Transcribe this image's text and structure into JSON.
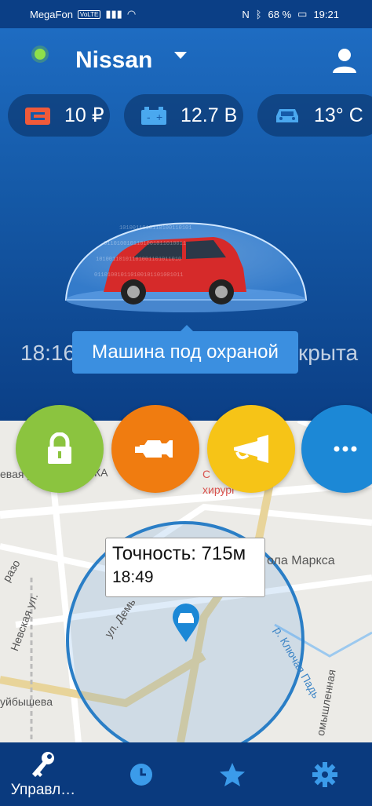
{
  "status_bar": {
    "carrier": "MegaFon",
    "volte": "VoLTE",
    "battery": "68 %",
    "time": "19:21"
  },
  "header": {
    "title": "Nissan"
  },
  "chips": [
    {
      "value": "10 ₽",
      "icon": "balance-icon"
    },
    {
      "value": "12.7 В",
      "icon": "battery-icon"
    },
    {
      "value": "13° C",
      "icon": "car-temperature-icon"
    }
  ],
  "status_row": {
    "time": "18:16",
    "trailing": "крыта"
  },
  "tooltip": "Машина под охраной",
  "actions": [
    {
      "name": "lock-button",
      "color": "#8bc43f"
    },
    {
      "name": "engine-button",
      "color": "#f07c10"
    },
    {
      "name": "horn-button",
      "color": "#f6c417"
    },
    {
      "name": "more-button",
      "color": "#1c88d6"
    }
  ],
  "map": {
    "accuracy": "Точность: 715м",
    "time": "18:49",
    "labels": [
      "евая ул.",
      "Невская ул.",
      "ул. Демь",
      "ола Маркса",
      "р. Ключая Падь",
      "уйбышева",
      "разо",
      "хирург",
      "С",
      "КА",
      "омышленная"
    ]
  },
  "nav": {
    "items": [
      {
        "label": "Управл…",
        "icon": "key-icon"
      },
      {
        "label": "",
        "icon": "clock-icon"
      },
      {
        "label": "",
        "icon": "star-icon"
      },
      {
        "label": "",
        "icon": "gear-icon"
      }
    ]
  }
}
